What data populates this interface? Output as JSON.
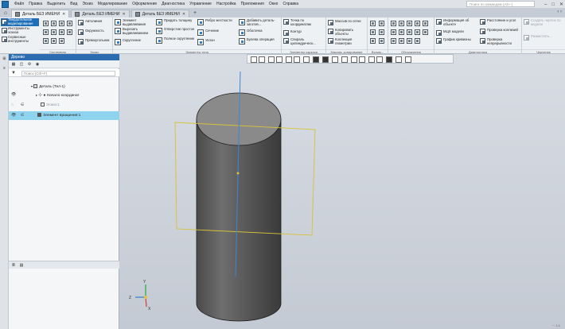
{
  "menu": [
    "Файл",
    "Правка",
    "Выделить",
    "Вид",
    "Эскиз",
    "Моделирование",
    "Оформление",
    "Диагностика",
    "Управление",
    "Настройка",
    "Приложения",
    "Окно",
    "Справка"
  ],
  "search_placeholder": "Поиск по командам (Alt+-)",
  "tabs": [
    {
      "label": "Деталь БЕЗ ИМЕНИ"
    },
    {
      "label": "Деталь БЕЗ ИМЕНИ"
    },
    {
      "label": "Деталь БЕЗ ИМЕНИ"
    }
  ],
  "ribbon": {
    "modes": [
      "Твердотельное моделирование",
      "Инструменты эскиза",
      "Сервисные инструменты"
    ],
    "group_labels": [
      "Системная",
      "Эскиз",
      "Элементы тела",
      "Элементы каркаса",
      "Массив, копирование",
      "Вспом...",
      "Обозначения",
      "Диагностика",
      "Черчение"
    ],
    "sketch": [
      "Автолиния",
      "Окружность",
      "Прямоугольник"
    ],
    "body1": [
      "Элемент выдавливания",
      "Вырезать выдавливанием",
      "Скругление"
    ],
    "body2": [
      "Придать толщину",
      "Отверстие простое",
      "Полное скругление"
    ],
    "body3": [
      "Ребро жесткости",
      "Сечение",
      "Уклон"
    ],
    "body4": [
      "Добавить деталь-заготов...",
      "Оболочка",
      "Булева операция"
    ],
    "frame": [
      "Точка по координатам",
      "Контур",
      "Спираль цилиндрическ..."
    ],
    "array": [
      "Массив по сетке",
      "Копировать объекты",
      "Коллекция геометрии"
    ],
    "diag1": [
      "Информация об объекте",
      "МЦХ модели",
      "График кривизны"
    ],
    "diag2": [
      "Расстояние и угол",
      "Проверка коллизий",
      "Проверка непрерывности"
    ],
    "draft": [
      "Создать чертеж по модели",
      "Разместить..."
    ]
  },
  "tree": {
    "title": "Дерево",
    "filter_placeholder": "Поиск (Ctrl+F)",
    "rows": [
      {
        "label": "Деталь (Тел-1)"
      },
      {
        "label": "Начало координат"
      },
      {
        "label": "Эскиз:1"
      },
      {
        "label": "Элемент вращения:1"
      }
    ]
  },
  "axes": {
    "x": "X",
    "y": "Y",
    "z": "Z"
  },
  "status": "⋯ 1:1"
}
